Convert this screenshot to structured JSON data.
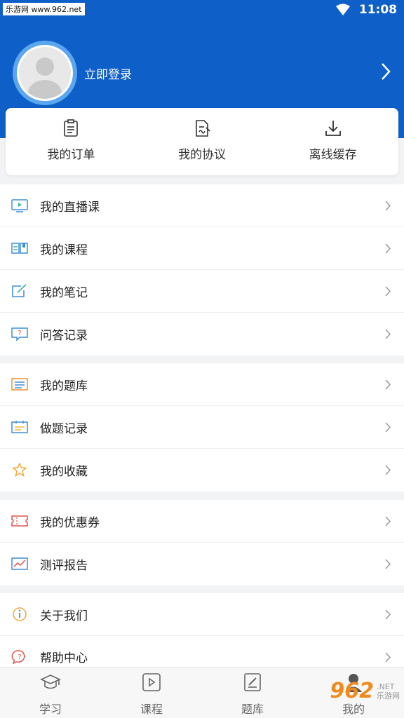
{
  "status_bar": {
    "watermark_text": "乐游网 www.962.net",
    "time": "11:08"
  },
  "header": {
    "login_label": "立即登录",
    "accent": "#0e5fc7"
  },
  "quick_actions": [
    {
      "label": "我的订单",
      "icon": "order-icon"
    },
    {
      "label": "我的协议",
      "icon": "agreement-icon"
    },
    {
      "label": "离线缓存",
      "icon": "download-icon"
    }
  ],
  "menu_groups": [
    [
      {
        "label": "我的直播课",
        "icon": "live-class-icon"
      },
      {
        "label": "我的课程",
        "icon": "course-icon"
      },
      {
        "label": "我的笔记",
        "icon": "notes-icon"
      },
      {
        "label": "问答记录",
        "icon": "qa-icon"
      }
    ],
    [
      {
        "label": "我的题库",
        "icon": "question-bank-icon"
      },
      {
        "label": "做题记录",
        "icon": "practice-record-icon"
      },
      {
        "label": "我的收藏",
        "icon": "star-icon"
      }
    ],
    [
      {
        "label": "我的优惠券",
        "icon": "coupon-icon"
      },
      {
        "label": "测评报告",
        "icon": "report-icon"
      }
    ],
    [
      {
        "label": "关于我们",
        "icon": "info-icon"
      },
      {
        "label": "帮助中心",
        "icon": "help-icon"
      }
    ]
  ],
  "tabs": [
    {
      "label": "学习",
      "icon": "graduation-cap-icon"
    },
    {
      "label": "课程",
      "icon": "play-icon"
    },
    {
      "label": "题库",
      "icon": "edit-doc-icon"
    },
    {
      "label": "我的",
      "icon": "person-icon"
    }
  ],
  "watermark_962": {
    "brand": "962",
    "suffix": ".NET",
    "site": "乐游网"
  }
}
